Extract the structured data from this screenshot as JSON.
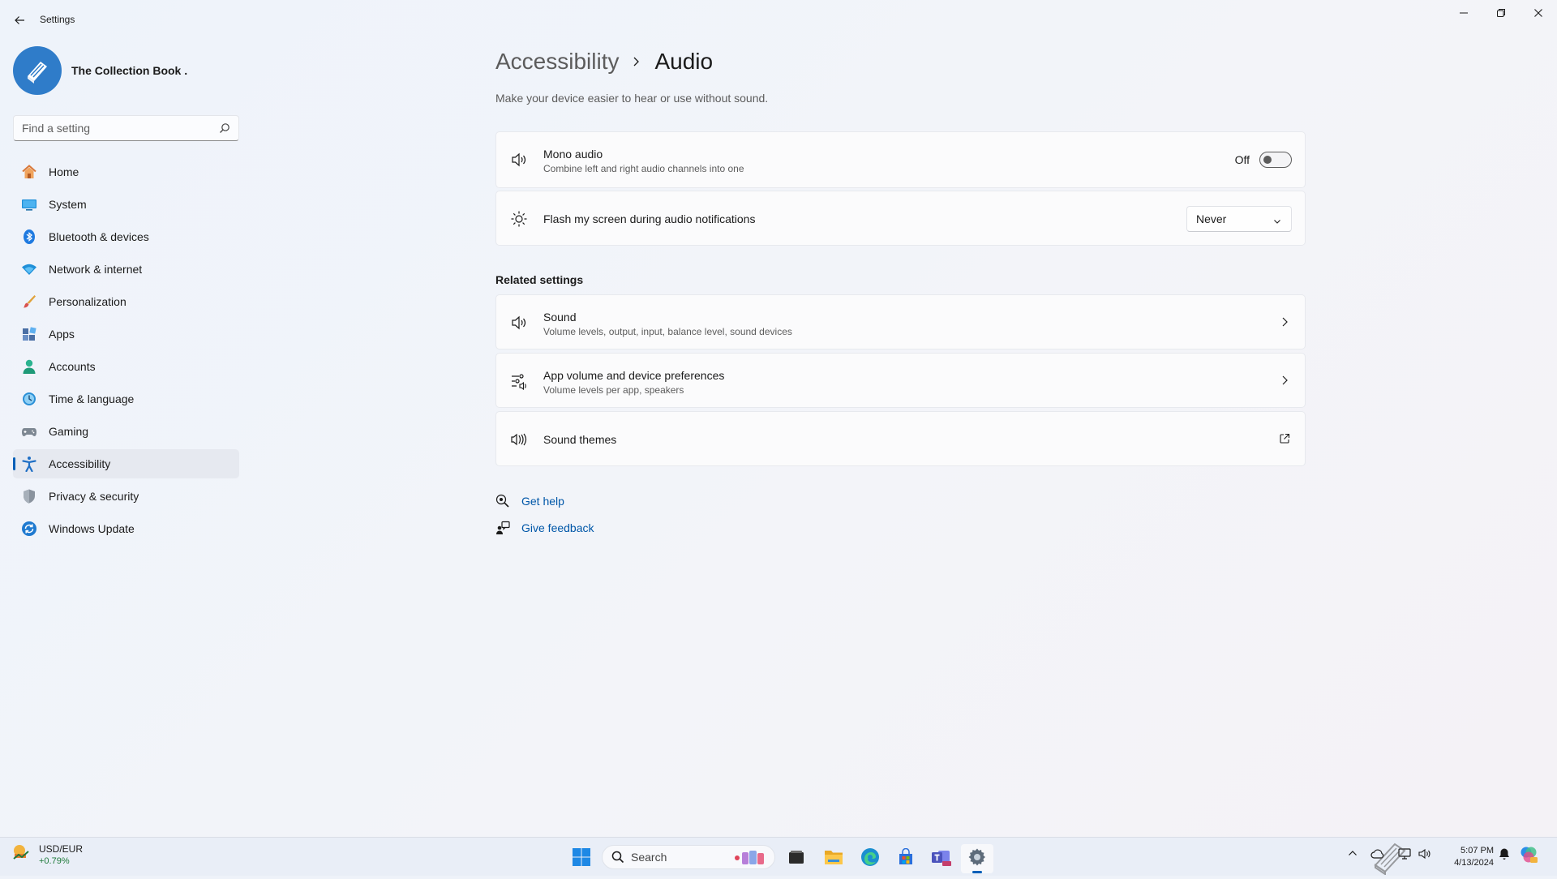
{
  "window": {
    "title": "Settings",
    "controls": [
      "minimize",
      "restore",
      "close"
    ]
  },
  "profile": {
    "name": "The Collection Book ."
  },
  "search": {
    "placeholder": "Find a setting"
  },
  "sidebar": {
    "items": [
      {
        "label": "Home",
        "icon": "home-icon"
      },
      {
        "label": "System",
        "icon": "system-icon"
      },
      {
        "label": "Bluetooth & devices",
        "icon": "bluetooth-icon"
      },
      {
        "label": "Network & internet",
        "icon": "wifi-icon"
      },
      {
        "label": "Personalization",
        "icon": "brush-icon"
      },
      {
        "label": "Apps",
        "icon": "apps-icon"
      },
      {
        "label": "Accounts",
        "icon": "accounts-icon"
      },
      {
        "label": "Time & language",
        "icon": "time-language-icon"
      },
      {
        "label": "Gaming",
        "icon": "gamepad-icon"
      },
      {
        "label": "Accessibility",
        "icon": "accessibility-icon",
        "active": true
      },
      {
        "label": "Privacy & security",
        "icon": "shield-icon"
      },
      {
        "label": "Windows Update",
        "icon": "update-icon"
      }
    ]
  },
  "main": {
    "breadcrumb_parent": "Accessibility",
    "page_title": "Audio",
    "subtitle": "Make your device easier to hear or use without sound.",
    "mono_audio": {
      "title": "Mono audio",
      "description": "Combine left and right audio channels into one",
      "toggle_label": "Off",
      "state": false
    },
    "flash_screen": {
      "title": "Flash my screen during audio notifications",
      "selected": "Never"
    },
    "related_heading": "Related settings",
    "related": [
      {
        "title": "Sound",
        "description": "Volume levels, output, input, balance level, sound devices",
        "icon": "speaker-icon",
        "action": "chevron-right-icon"
      },
      {
        "title": "App volume and device preferences",
        "description": "Volume levels per app, speakers",
        "icon": "mixer-icon",
        "action": "chevron-right-icon"
      },
      {
        "title": "Sound themes",
        "description": "",
        "icon": "sound-wave-icon",
        "action": "open-external-icon"
      }
    ],
    "help": {
      "get_help": "Get help",
      "give_feedback": "Give feedback"
    }
  },
  "taskbar": {
    "widget": {
      "name": "USD/EUR",
      "change": "+0.79%"
    },
    "search_label": "Search",
    "pinned": [
      "start-icon",
      "search",
      "task-view-icon",
      "file-explorer-icon",
      "edge-icon",
      "store-icon",
      "teams-icon",
      "settings-icon"
    ],
    "clock": {
      "time": "5:07 PM",
      "date": "4/13/2024"
    }
  },
  "colors": {
    "accent": "#005fb8",
    "link": "#0057a8",
    "avatar": "#2f7cc9",
    "positive": "#1f7a3a"
  }
}
